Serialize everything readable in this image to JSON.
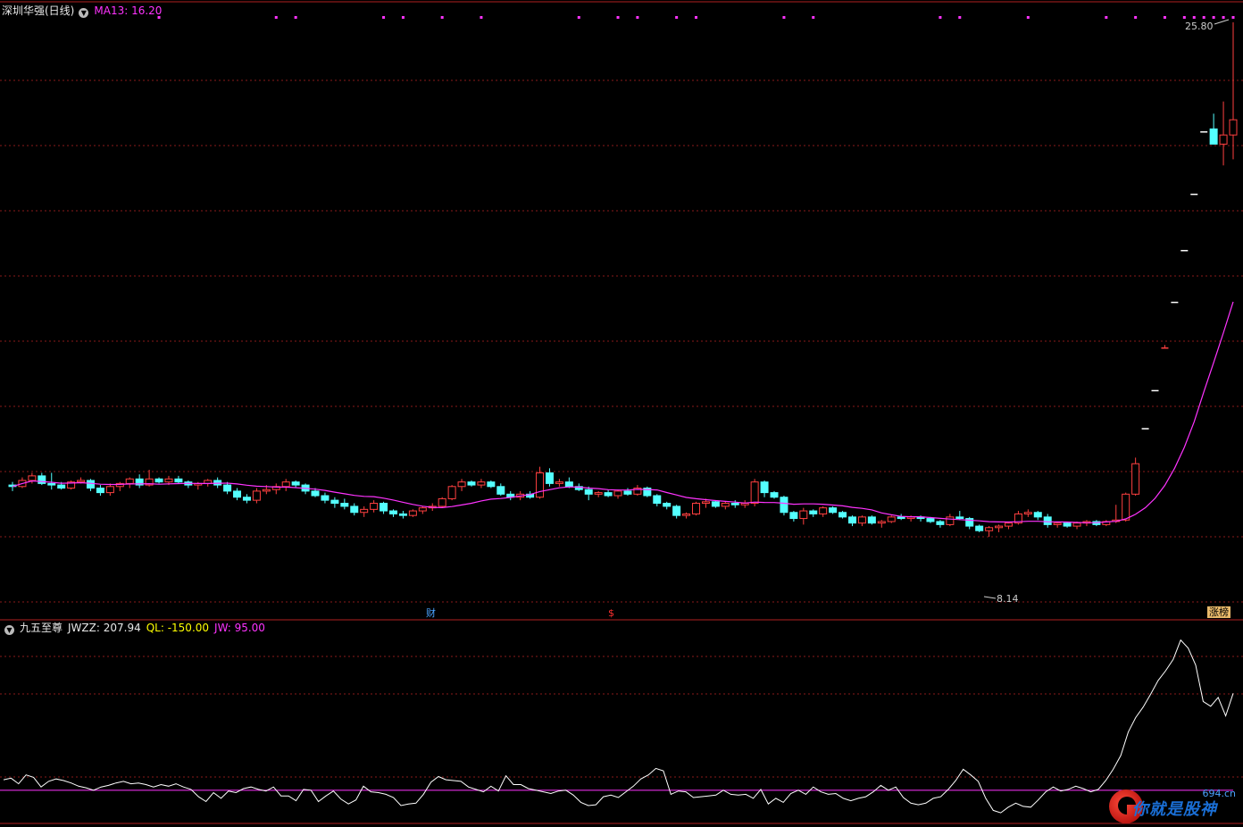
{
  "main_header": {
    "stock": "深圳华强(日线)",
    "ma_label": "MA13: 16.20"
  },
  "sub_header": {
    "indicator": "九五至尊",
    "jwzz": "JWZZ: 207.94",
    "ql": "QL: -150.00",
    "jw": "JW: 95.00"
  },
  "markers": {
    "high": "25.80",
    "low": "8.14",
    "cai": "财",
    "dollar": "$",
    "zhangting": "涨榜"
  },
  "watermark": {
    "text": "你就是股神",
    "domain": "694.cn"
  },
  "colors": {
    "up": "#ff4040",
    "down": "#54ffff",
    "ma": "#ff33ff",
    "grid": "#8a1a1a",
    "line": "#ffffff"
  },
  "chart_data": {
    "type": "candlestick",
    "price_range": [
      7.0,
      26.6
    ],
    "ma_period": 13,
    "candles_ohlc": [
      [
        10.9,
        11.0,
        10.7,
        10.85
      ],
      [
        10.85,
        11.15,
        10.8,
        11.05
      ],
      [
        11.05,
        11.3,
        10.95,
        11.2
      ],
      [
        11.2,
        11.3,
        10.9,
        10.95
      ],
      [
        10.95,
        11.3,
        10.75,
        10.9
      ],
      [
        10.9,
        11.0,
        10.75,
        10.8
      ],
      [
        10.8,
        11.05,
        10.75,
        11.0
      ],
      [
        11.0,
        11.15,
        10.95,
        11.05
      ],
      [
        11.05,
        11.1,
        10.7,
        10.8
      ],
      [
        10.8,
        10.9,
        10.55,
        10.65
      ],
      [
        10.65,
        10.95,
        10.55,
        10.85
      ],
      [
        10.85,
        11.0,
        10.7,
        10.95
      ],
      [
        10.95,
        11.15,
        10.8,
        11.1
      ],
      [
        11.1,
        11.25,
        10.8,
        10.9
      ],
      [
        10.9,
        11.4,
        10.85,
        11.1
      ],
      [
        11.1,
        11.15,
        10.95,
        11.0
      ],
      [
        11.0,
        11.2,
        10.9,
        11.1
      ],
      [
        11.1,
        11.2,
        10.95,
        11.0
      ],
      [
        11.0,
        11.05,
        10.8,
        10.9
      ],
      [
        10.9,
        11.0,
        10.75,
        10.95
      ],
      [
        10.95,
        11.1,
        10.85,
        11.05
      ],
      [
        11.05,
        11.15,
        10.8,
        10.9
      ],
      [
        10.9,
        11.0,
        10.6,
        10.7
      ],
      [
        10.7,
        10.8,
        10.4,
        10.5
      ],
      [
        10.5,
        10.6,
        10.3,
        10.4
      ],
      [
        10.4,
        10.8,
        10.3,
        10.7
      ],
      [
        10.7,
        10.9,
        10.6,
        10.75
      ],
      [
        10.75,
        10.95,
        10.6,
        10.85
      ],
      [
        10.85,
        11.1,
        10.7,
        11.0
      ],
      [
        11.0,
        11.05,
        10.8,
        10.9
      ],
      [
        10.9,
        10.95,
        10.6,
        10.7
      ],
      [
        10.7,
        10.8,
        10.5,
        10.55
      ],
      [
        10.55,
        10.65,
        10.3,
        10.4
      ],
      [
        10.4,
        10.5,
        10.15,
        10.3
      ],
      [
        10.3,
        10.45,
        10.1,
        10.2
      ],
      [
        10.2,
        10.3,
        9.9,
        10.0
      ],
      [
        10.0,
        10.2,
        9.85,
        10.1
      ],
      [
        10.1,
        10.4,
        10.0,
        10.3
      ],
      [
        10.3,
        10.35,
        9.95,
        10.05
      ],
      [
        10.05,
        10.1,
        9.85,
        9.95
      ],
      [
        9.95,
        10.05,
        9.8,
        9.9
      ],
      [
        9.9,
        10.1,
        9.85,
        10.05
      ],
      [
        10.05,
        10.2,
        9.95,
        10.15
      ],
      [
        10.15,
        10.3,
        10.05,
        10.2
      ],
      [
        10.2,
        10.5,
        10.15,
        10.45
      ],
      [
        10.45,
        10.9,
        10.4,
        10.85
      ],
      [
        10.85,
        11.1,
        10.7,
        11.0
      ],
      [
        11.0,
        11.05,
        10.85,
        10.9
      ],
      [
        10.9,
        11.1,
        10.8,
        11.0
      ],
      [
        11.0,
        11.05,
        10.8,
        10.85
      ],
      [
        10.85,
        10.95,
        10.55,
        10.6
      ],
      [
        10.6,
        10.7,
        10.4,
        10.5
      ],
      [
        10.5,
        10.7,
        10.4,
        10.6
      ],
      [
        10.6,
        10.7,
        10.45,
        10.5
      ],
      [
        10.5,
        11.5,
        10.45,
        11.3
      ],
      [
        11.3,
        11.45,
        10.85,
        10.95
      ],
      [
        10.95,
        11.1,
        10.85,
        11.0
      ],
      [
        11.0,
        11.15,
        10.8,
        10.85
      ],
      [
        10.85,
        10.95,
        10.7,
        10.75
      ],
      [
        10.75,
        10.85,
        10.4,
        10.6
      ],
      [
        10.6,
        10.7,
        10.5,
        10.65
      ],
      [
        10.65,
        10.75,
        10.5,
        10.55
      ],
      [
        10.55,
        10.75,
        10.45,
        10.7
      ],
      [
        10.7,
        10.8,
        10.55,
        10.6
      ],
      [
        10.6,
        10.9,
        10.55,
        10.8
      ],
      [
        10.8,
        10.85,
        10.5,
        10.55
      ],
      [
        10.55,
        10.6,
        10.2,
        10.3
      ],
      [
        10.3,
        10.35,
        10.1,
        10.2
      ],
      [
        10.2,
        10.25,
        9.8,
        9.9
      ],
      [
        9.9,
        10.0,
        9.8,
        9.95
      ],
      [
        9.95,
        10.35,
        9.9,
        10.3
      ],
      [
        10.3,
        10.45,
        10.15,
        10.35
      ],
      [
        10.35,
        10.4,
        10.15,
        10.2
      ],
      [
        10.2,
        10.35,
        10.1,
        10.3
      ],
      [
        10.3,
        10.4,
        10.15,
        10.25
      ],
      [
        10.25,
        10.4,
        10.15,
        10.3
      ],
      [
        10.3,
        11.1,
        10.2,
        11.0
      ],
      [
        11.0,
        11.05,
        10.5,
        10.65
      ],
      [
        10.65,
        10.7,
        10.45,
        10.5
      ],
      [
        10.5,
        10.55,
        9.9,
        10.0
      ],
      [
        10.0,
        10.05,
        9.7,
        9.8
      ],
      [
        9.8,
        10.15,
        9.6,
        10.05
      ],
      [
        10.05,
        10.1,
        9.85,
        9.95
      ],
      [
        9.95,
        10.2,
        9.85,
        10.15
      ],
      [
        10.15,
        10.2,
        9.95,
        10.0
      ],
      [
        10.0,
        10.05,
        9.8,
        9.85
      ],
      [
        9.85,
        9.9,
        9.55,
        9.65
      ],
      [
        9.65,
        9.9,
        9.55,
        9.85
      ],
      [
        9.85,
        9.9,
        9.6,
        9.65
      ],
      [
        9.65,
        9.75,
        9.5,
        9.7
      ],
      [
        9.7,
        9.9,
        9.65,
        9.85
      ],
      [
        9.85,
        9.95,
        9.75,
        9.8
      ],
      [
        9.8,
        9.9,
        9.7,
        9.85
      ],
      [
        9.85,
        9.9,
        9.7,
        9.8
      ],
      [
        9.8,
        9.85,
        9.65,
        9.7
      ],
      [
        9.7,
        9.75,
        9.5,
        9.6
      ],
      [
        9.6,
        9.95,
        9.55,
        9.85
      ],
      [
        9.85,
        10.05,
        9.75,
        9.8
      ],
      [
        9.8,
        9.85,
        9.45,
        9.55
      ],
      [
        9.55,
        9.6,
        9.35,
        9.4
      ],
      [
        9.4,
        9.55,
        9.2,
        9.5
      ],
      [
        9.5,
        9.6,
        9.35,
        9.55
      ],
      [
        9.55,
        9.7,
        9.45,
        9.65
      ],
      [
        9.65,
        10.05,
        9.6,
        9.95
      ],
      [
        9.95,
        10.1,
        9.85,
        10.0
      ],
      [
        10.0,
        10.05,
        9.75,
        9.85
      ],
      [
        9.85,
        9.95,
        9.5,
        9.6
      ],
      [
        9.6,
        9.7,
        9.5,
        9.65
      ],
      [
        9.65,
        9.7,
        9.5,
        9.55
      ],
      [
        9.55,
        9.7,
        9.45,
        9.65
      ],
      [
        9.65,
        9.75,
        9.55,
        9.7
      ],
      [
        9.7,
        9.75,
        9.55,
        9.6
      ],
      [
        9.6,
        9.75,
        9.55,
        9.7
      ],
      [
        9.7,
        10.25,
        9.65,
        9.75
      ],
      [
        9.75,
        10.65,
        9.7,
        10.6
      ],
      [
        10.6,
        11.8,
        10.55,
        11.6
      ],
      [
        12.75,
        12.75,
        12.75,
        12.75
      ],
      [
        14.0,
        14.0,
        14.0,
        14.0
      ],
      [
        15.4,
        15.5,
        15.4,
        15.4
      ],
      [
        16.9,
        16.9,
        16.9,
        16.9
      ],
      [
        18.6,
        18.6,
        18.6,
        18.6
      ],
      [
        20.45,
        20.45,
        20.45,
        20.45
      ],
      [
        22.5,
        22.5,
        22.5,
        22.5
      ],
      [
        22.6,
        23.1,
        22.3,
        22.1
      ],
      [
        22.1,
        23.5,
        21.4,
        22.4
      ],
      [
        22.4,
        26.1,
        21.6,
        22.9
      ]
    ],
    "indicator_series": {
      "name": "JWZZ",
      "values": [
        -137,
        -135,
        -142,
        -131,
        -134,
        -146,
        -139,
        -136,
        -138,
        -141,
        -145,
        -147,
        -150,
        -146,
        -144,
        -141,
        -139,
        -142,
        -141,
        -143,
        -146,
        -143,
        -145,
        -142,
        -146,
        -149,
        -158,
        -164,
        -153,
        -160,
        -151,
        -153,
        -148,
        -146,
        -149,
        -151,
        -146,
        -157,
        -157,
        -163,
        -149,
        -150,
        -164,
        -157,
        -151,
        -161,
        -167,
        -162,
        -145,
        -152,
        -153,
        -155,
        -159,
        -169,
        -167,
        -166,
        -155,
        -140,
        -133,
        -137,
        -138,
        -139,
        -146,
        -149,
        -152,
        -145,
        -151,
        -132,
        -143,
        -143,
        -148,
        -150,
        -152,
        -154,
        -151,
        -150,
        -156,
        -165,
        -169,
        -168,
        -158,
        -156,
        -159,
        -152,
        -145,
        -136,
        -131,
        -123,
        -126,
        -155,
        -151,
        -152,
        -159,
        -158,
        -157,
        -156,
        -150,
        -155,
        -156,
        -155,
        -160,
        -149,
        -167,
        -160,
        -165,
        -154,
        -150,
        -155,
        -146,
        -152,
        -155,
        -154,
        -160,
        -163,
        -160,
        -158,
        -152,
        -144,
        -150,
        -146,
        -159,
        -166,
        -168,
        -166,
        -160,
        -158,
        -149,
        -138,
        -124,
        -131,
        -139,
        -160,
        -175,
        -178,
        -171,
        -166,
        -170,
        -171,
        -162,
        -152,
        -146,
        -151,
        -149,
        -145,
        -148,
        -152,
        -149,
        -138,
        -124,
        -107,
        -78,
        -60,
        -47,
        -31,
        -14,
        -2,
        12,
        36,
        26,
        5,
        -40,
        -46,
        -35,
        -58,
        -30
      ],
      "ql_value": -150.0,
      "jw_value": 95.0,
      "last_value": 207.94
    }
  }
}
